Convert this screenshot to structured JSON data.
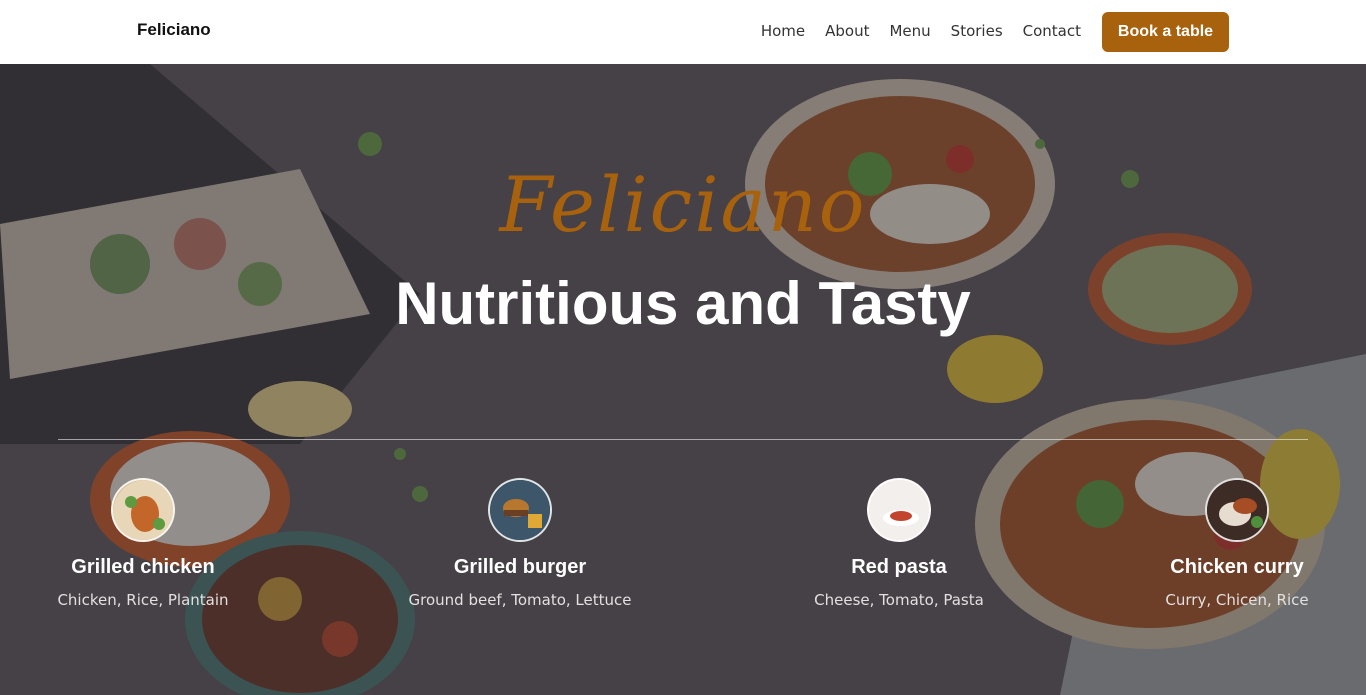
{
  "brand": "Feliciano",
  "nav": {
    "links": [
      "Home",
      "About",
      "Menu",
      "Stories",
      "Contact"
    ],
    "cta": "Book a table"
  },
  "hero": {
    "script_title": "Feliciano",
    "title": "Nutritious and Tasty"
  },
  "dishes": [
    {
      "name": "Grilled chicken",
      "ingredients": "Chicken, Rice, Plantain"
    },
    {
      "name": "Grilled burger",
      "ingredients": "Ground beef, Tomato, Lettuce"
    },
    {
      "name": "Red pasta",
      "ingredients": "Cheese, Tomato, Pasta"
    },
    {
      "name": "Chicken curry",
      "ingredients": "Curry, Chicen, Rice"
    }
  ],
  "colors": {
    "accent": "#a8620e",
    "navbar_bg": "#ffffff",
    "hero_text": "#ffffff"
  }
}
